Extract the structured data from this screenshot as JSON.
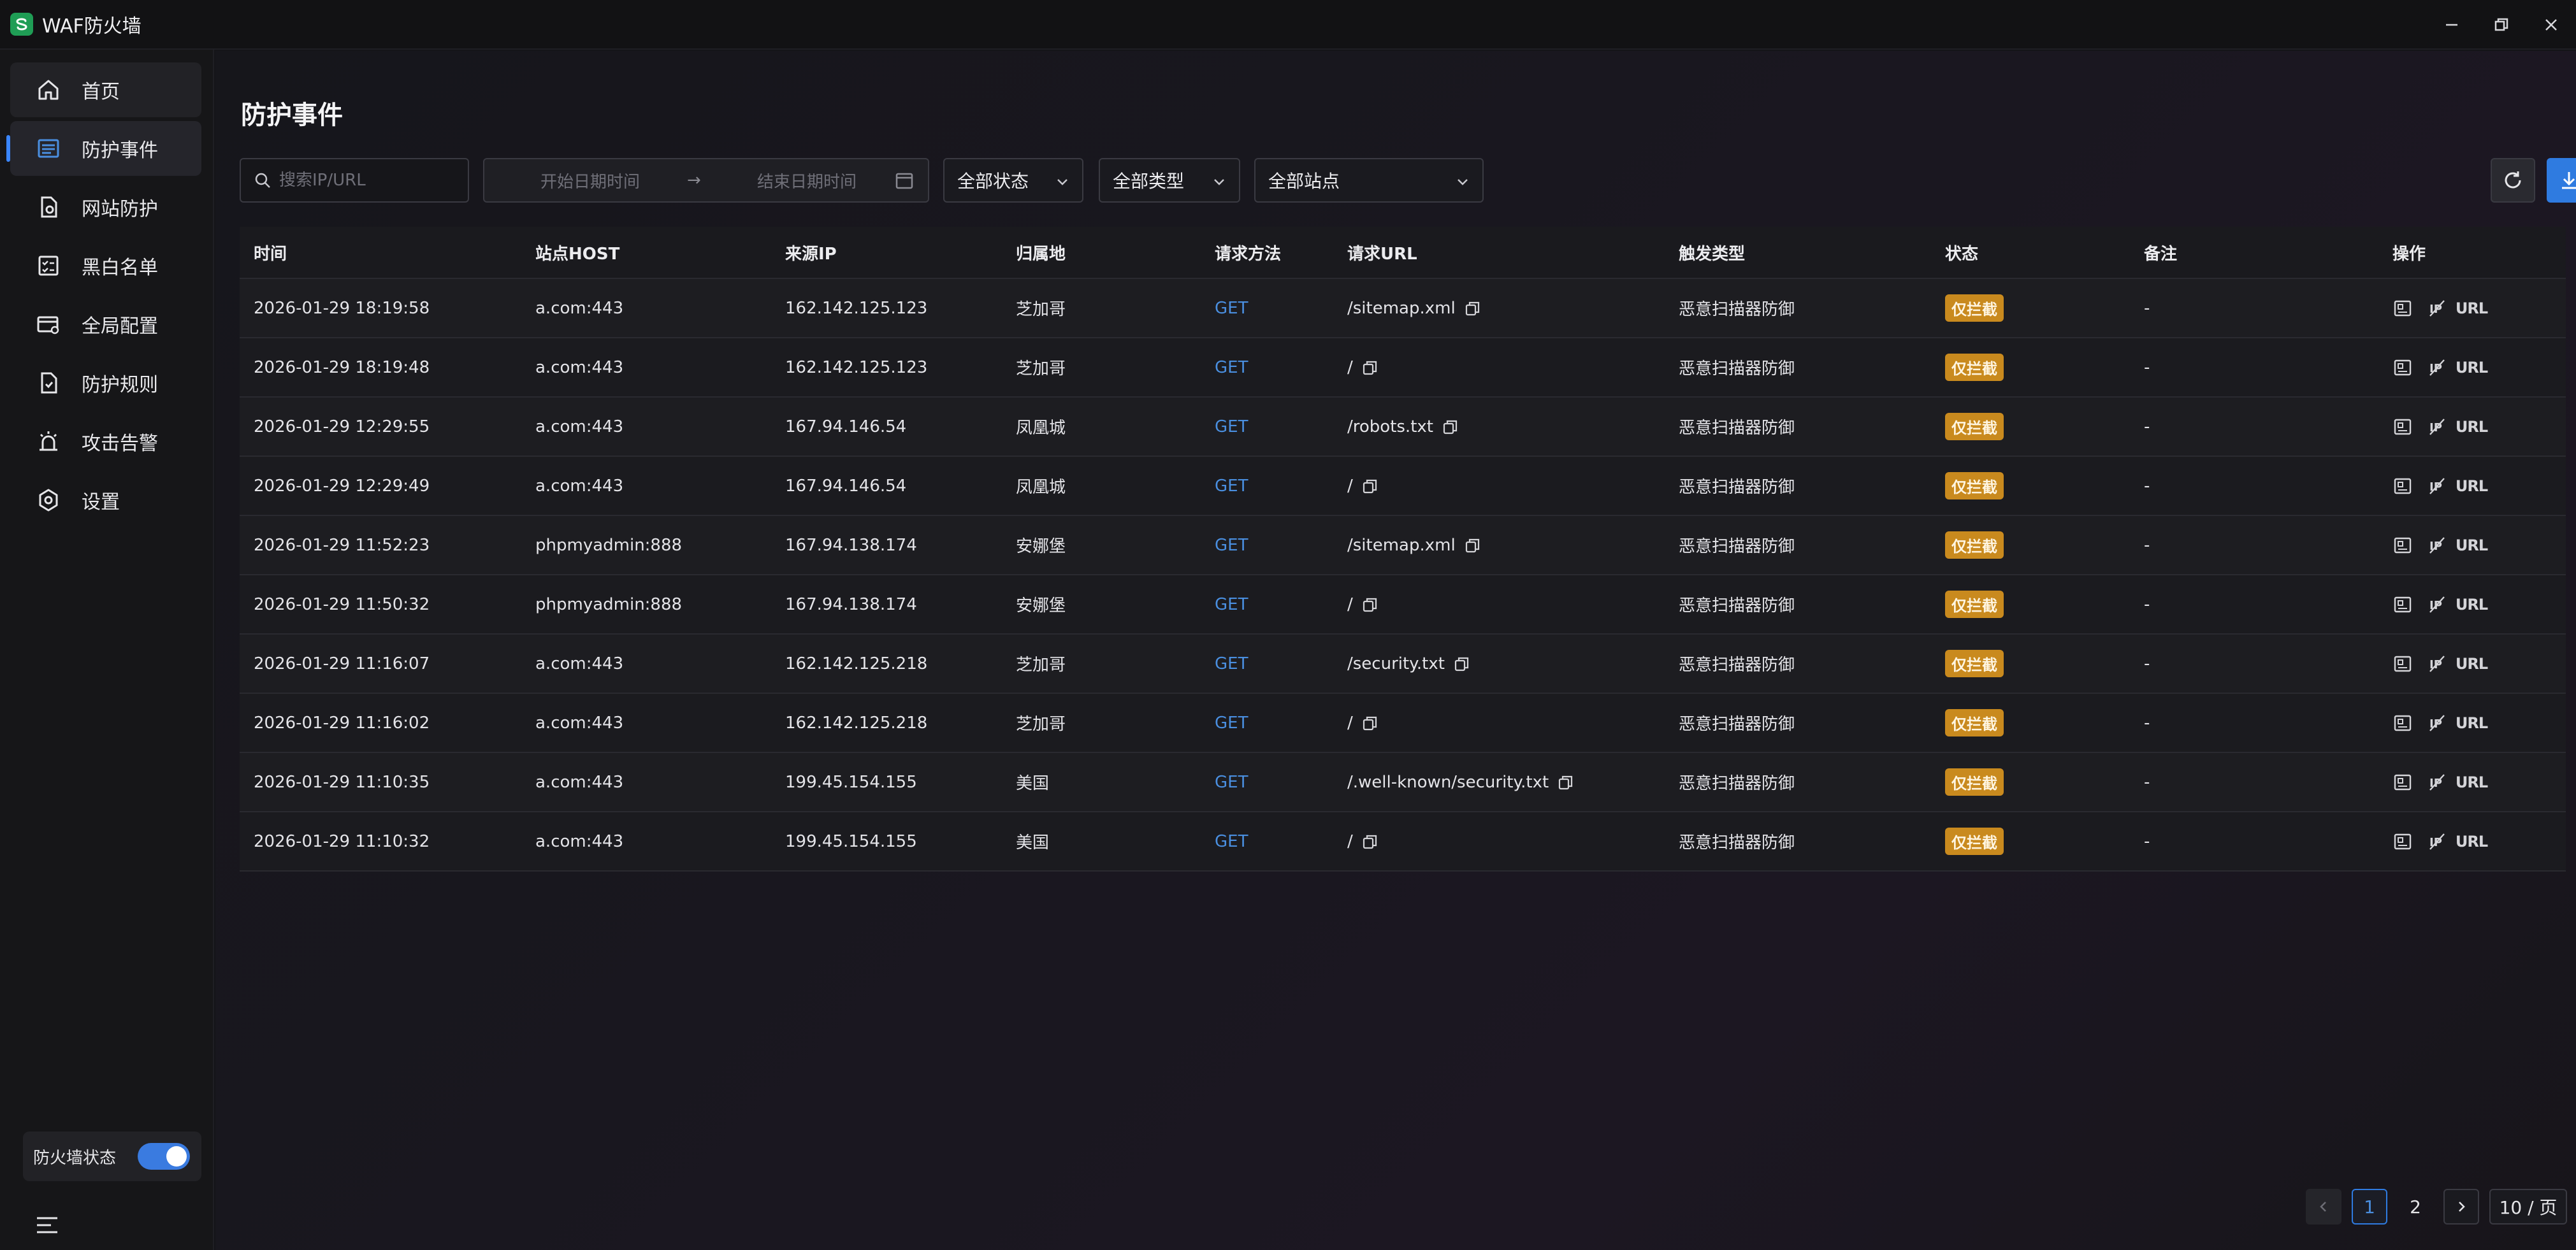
{
  "app": {
    "title": "WAF防火墙",
    "logo_icon": "waf-logo-icon"
  },
  "window": {
    "minimize": "—",
    "restore": "❐",
    "close": "✕"
  },
  "sidebar": {
    "items": [
      {
        "label": "首页",
        "icon": "home-icon"
      },
      {
        "label": "防护事件",
        "icon": "list-icon"
      },
      {
        "label": "网站防护",
        "icon": "shield-file-icon"
      },
      {
        "label": "黑白名单",
        "icon": "checklist-icon"
      },
      {
        "label": "全局配置",
        "icon": "card-settings-icon"
      },
      {
        "label": "防护规则",
        "icon": "rules-icon"
      },
      {
        "label": "攻击告警",
        "icon": "alarm-icon"
      },
      {
        "label": "设置",
        "icon": "gear-icon"
      }
    ],
    "firewall_status": {
      "label": "防火墙状态",
      "enabled": true
    }
  },
  "main": {
    "title": "防护事件",
    "search_placeholder": "搜索IP/URL",
    "date_start_placeholder": "开始日期时间",
    "date_arrow": "→",
    "date_end_placeholder": "结束日期时间",
    "filters": {
      "status": "全部状态",
      "type": "全部类型",
      "site": "全部站点"
    }
  },
  "table": {
    "headers": [
      "时间",
      "站点HOST",
      "来源IP",
      "归属地",
      "请求方法",
      "请求URL",
      "触发类型",
      "状态",
      "备注",
      "操作"
    ],
    "rows": [
      {
        "time": "2026-01-29 18:19:58",
        "host": "a.com:443",
        "ip": "162.142.125.123",
        "loc": "芝加哥",
        "method": "GET",
        "url": "/sitemap.xml",
        "type": "恶意扫描器防御",
        "status": "仅拦截",
        "note": "-"
      },
      {
        "time": "2026-01-29 18:19:48",
        "host": "a.com:443",
        "ip": "162.142.125.123",
        "loc": "芝加哥",
        "method": "GET",
        "url": "/",
        "type": "恶意扫描器防御",
        "status": "仅拦截",
        "note": "-"
      },
      {
        "time": "2026-01-29 12:29:55",
        "host": "a.com:443",
        "ip": "167.94.146.54",
        "loc": "凤凰城",
        "method": "GET",
        "url": "/robots.txt",
        "type": "恶意扫描器防御",
        "status": "仅拦截",
        "note": "-"
      },
      {
        "time": "2026-01-29 12:29:49",
        "host": "a.com:443",
        "ip": "167.94.146.54",
        "loc": "凤凰城",
        "method": "GET",
        "url": "/",
        "type": "恶意扫描器防御",
        "status": "仅拦截",
        "note": "-"
      },
      {
        "time": "2026-01-29 11:52:23",
        "host": "phpmyadmin:888",
        "ip": "167.94.138.174",
        "loc": "安娜堡",
        "method": "GET",
        "url": "/sitemap.xml",
        "type": "恶意扫描器防御",
        "status": "仅拦截",
        "note": "-"
      },
      {
        "time": "2026-01-29 11:50:32",
        "host": "phpmyadmin:888",
        "ip": "167.94.138.174",
        "loc": "安娜堡",
        "method": "GET",
        "url": "/",
        "type": "恶意扫描器防御",
        "status": "仅拦截",
        "note": "-"
      },
      {
        "time": "2026-01-29 11:16:07",
        "host": "a.com:443",
        "ip": "162.142.125.218",
        "loc": "芝加哥",
        "method": "GET",
        "url": "/security.txt",
        "type": "恶意扫描器防御",
        "status": "仅拦截",
        "note": "-"
      },
      {
        "time": "2026-01-29 11:16:02",
        "host": "a.com:443",
        "ip": "162.142.125.218",
        "loc": "芝加哥",
        "method": "GET",
        "url": "/",
        "type": "恶意扫描器防御",
        "status": "仅拦截",
        "note": "-"
      },
      {
        "time": "2026-01-29 11:10:35",
        "host": "a.com:443",
        "ip": "199.45.154.155",
        "loc": "美国",
        "method": "GET",
        "url": "/.well-known/security.txt",
        "type": "恶意扫描器防御",
        "status": "仅拦截",
        "note": "-"
      },
      {
        "time": "2026-01-29 11:10:32",
        "host": "a.com:443",
        "ip": "199.45.154.155",
        "loc": "美国",
        "method": "GET",
        "url": "/",
        "type": "恶意扫描器防御",
        "status": "仅拦截",
        "note": "-"
      }
    ],
    "op_url_label": "URL"
  },
  "pagination": {
    "prev": "‹",
    "pages": [
      "1",
      "2"
    ],
    "current": "1",
    "next": "›",
    "page_size": "10 / 页"
  },
  "colors": {
    "accent": "#2f7be0",
    "badge": "#c98a1e",
    "method": "#4a8fe0"
  }
}
